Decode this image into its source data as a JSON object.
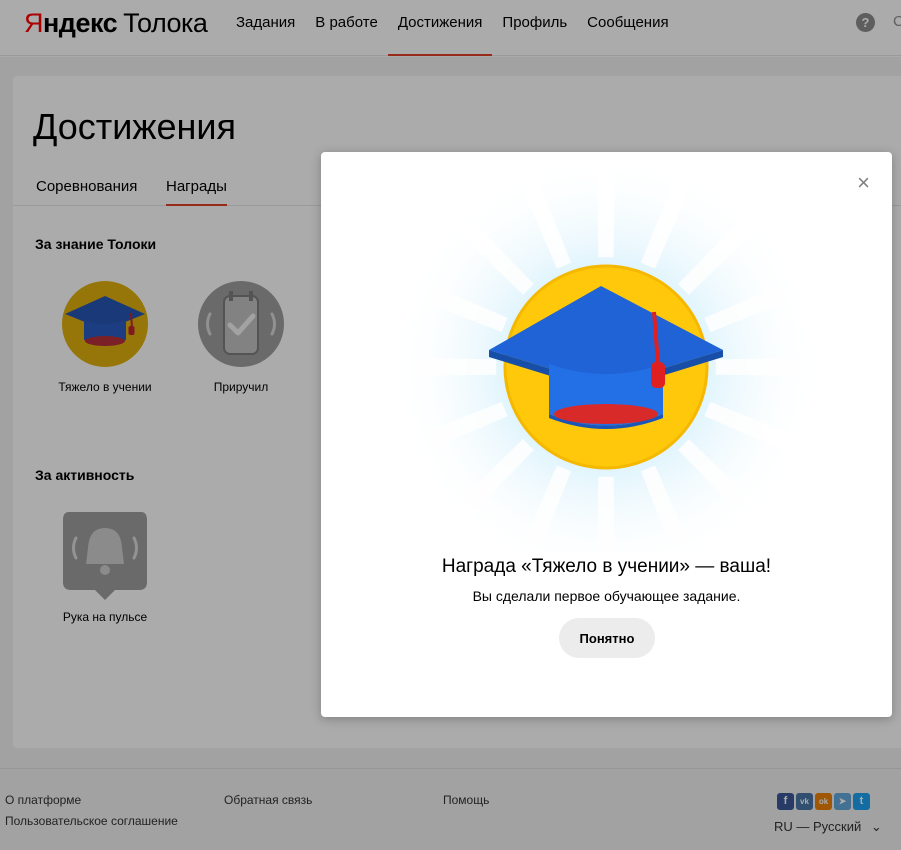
{
  "header": {
    "logo_brand_first": "Я",
    "logo_brand_rest": "ндекс",
    "logo_product": "Толока",
    "nav": [
      "Задания",
      "В работе",
      "Достижения",
      "Профиль",
      "Сообщения"
    ],
    "active_nav": "Достижения",
    "help_label": "?",
    "cut_text": "С"
  },
  "page": {
    "title": "Достижения",
    "tabs": [
      "Соревнования",
      "Награды"
    ],
    "active_tab": "Награды",
    "sections": [
      {
        "title": "За знание Толоки",
        "badges": [
          {
            "label": "Тяжело в учении",
            "icon": "graduation-cap-icon",
            "earned": true
          },
          {
            "label": "Приручил",
            "icon": "phone-check-icon",
            "earned": false
          }
        ]
      },
      {
        "title": "За активность",
        "badges": [
          {
            "label": "Рука на пульсе",
            "icon": "bell-icon",
            "earned": false
          }
        ]
      }
    ]
  },
  "footer": {
    "links": [
      "О платформе",
      "Пользовательское соглашение",
      "Обратная связь",
      "Помощь"
    ],
    "social": [
      {
        "name": "facebook-icon",
        "label": "f",
        "color": "#3b5998"
      },
      {
        "name": "vk-icon",
        "label": "vk",
        "color": "#4a76a8"
      },
      {
        "name": "odnoklassniki-icon",
        "label": "ok",
        "color": "#ee8208"
      },
      {
        "name": "telegram-icon",
        "label": "➤",
        "color": "#64a9dc"
      },
      {
        "name": "twitter-icon",
        "label": "t",
        "color": "#1da1f2"
      }
    ],
    "language": "RU — Русский",
    "language_chevron": "⌄"
  },
  "modal": {
    "title": "Награда «Тяжело в учении» — ваша!",
    "text": "Вы сделали первое обучающее задание.",
    "button": "Понятно",
    "close": "×",
    "icon": "graduation-cap-icon"
  },
  "colors": {
    "accent": "#e0412b",
    "badge_gold": "#ffc80a",
    "cap_blue": "#1f63d6",
    "tassel_red": "#e02020",
    "inactive_badge": "#9e9e9e"
  }
}
